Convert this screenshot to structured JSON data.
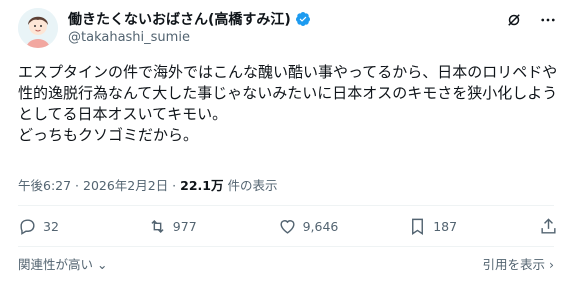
{
  "author": {
    "display_name": "働きたくないおばさん(高橋すみ江)",
    "handle": "@takahashi_sumie",
    "verified_color": "#1d9bf0"
  },
  "tweet": {
    "text": "エスプタインの件で海外ではこんな醜い酷い事やってるから、日本のロリペドや性的逸脱行為なんて大した事じゃないみたいに日本オスのキモさを狭小化しようとしてる日本オスいてキモい。\nどっちもクソゴミだから。",
    "time": "午後6:27 · 2026年2月2日 · ",
    "views": "22.1万",
    "views_suffix": " 件の表示"
  },
  "actions": {
    "replies": "32",
    "reposts": "977",
    "likes": "9,646",
    "bookmarks": "187"
  },
  "footer": {
    "relevance": "関連性が高い",
    "quotes": "引用を表示 ›"
  },
  "icons": [
    "grok-icon",
    "more-icon",
    "reply-icon",
    "repost-icon",
    "like-icon",
    "bookmark-icon",
    "share-icon",
    "chevron-down-icon",
    "verified-badge-icon"
  ]
}
